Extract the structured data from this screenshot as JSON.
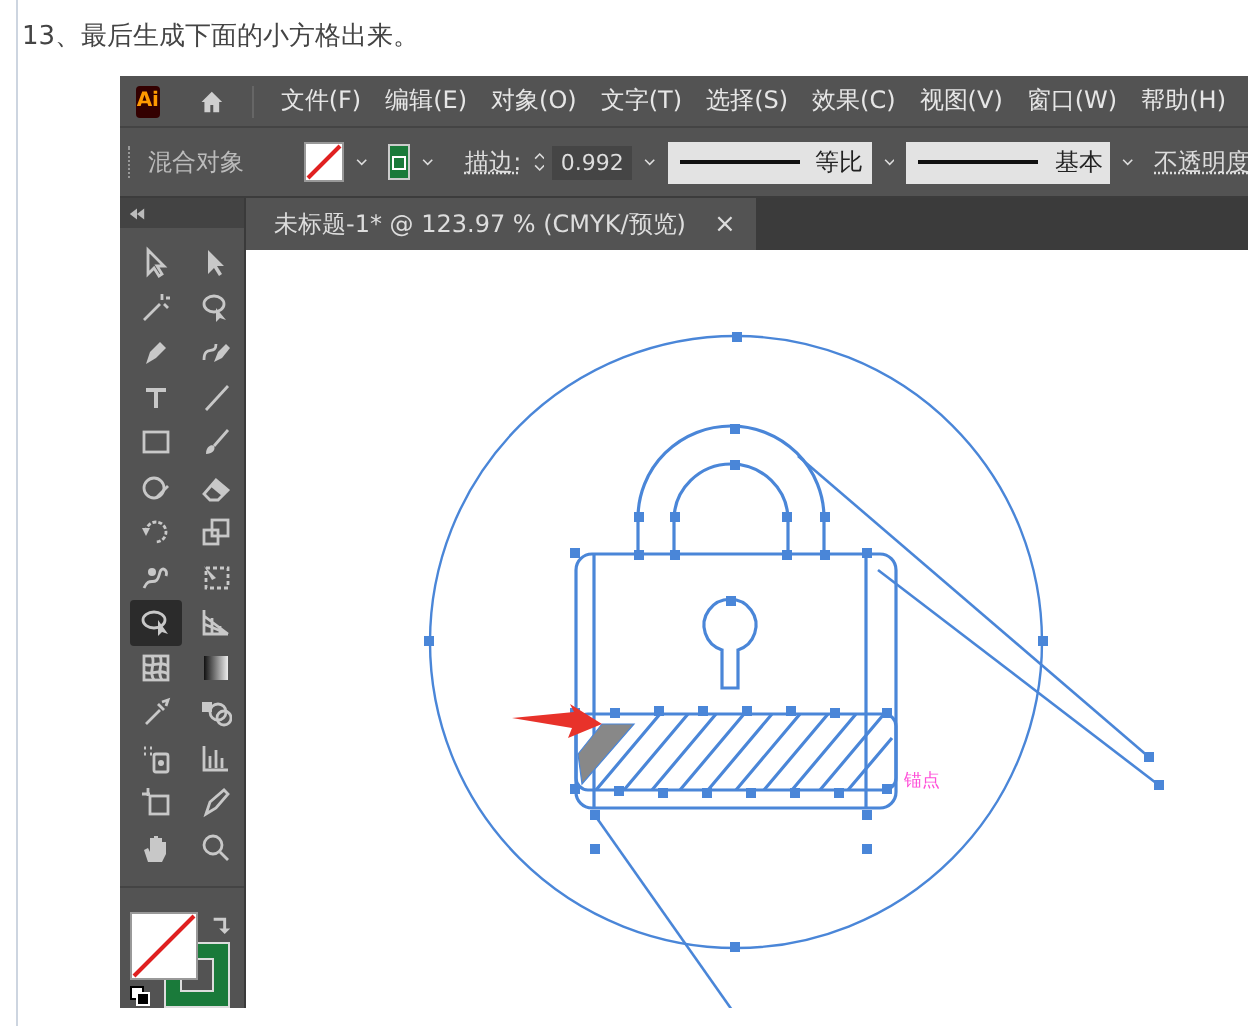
{
  "caption": "13、最后生成下面的小方格出来。",
  "app_logo": "Ai",
  "menu": [
    "文件(F)",
    "编辑(E)",
    "对象(O)",
    "文字(T)",
    "选择(S)",
    "效果(C)",
    "视图(V)",
    "窗口(W)",
    "帮助(H)"
  ],
  "control_bar": {
    "label": "混合对象",
    "stroke_label": "描边:",
    "stroke_weight": "0.992",
    "profile": "等比",
    "brush": "基本",
    "opacity_label": "不透明度"
  },
  "document_tab": {
    "title": "未标题-1* @ 123.97 % (CMYK/预览)",
    "close": "×"
  },
  "tools": [
    {
      "selected": false
    },
    {
      "selected": false
    },
    {
      "selected": false
    },
    {
      "selected": false
    },
    {
      "selected": false
    },
    {
      "selected": false
    },
    {
      "selected": false
    },
    {
      "selected": false
    },
    {
      "selected": false
    },
    {
      "selected": false
    },
    {
      "selected": false
    },
    {
      "selected": false
    },
    {
      "selected": false
    },
    {
      "selected": false
    },
    {
      "selected": false
    },
    {
      "selected": false
    },
    {
      "selected": true
    },
    {
      "selected": false
    },
    {
      "selected": false
    },
    {
      "selected": false
    },
    {
      "selected": false
    },
    {
      "selected": false
    },
    {
      "selected": false
    },
    {
      "selected": false
    },
    {
      "selected": false
    },
    {
      "selected": false
    },
    {
      "selected": false
    },
    {
      "selected": false
    }
  ],
  "canvas": {
    "anchor_label": "锚点"
  }
}
